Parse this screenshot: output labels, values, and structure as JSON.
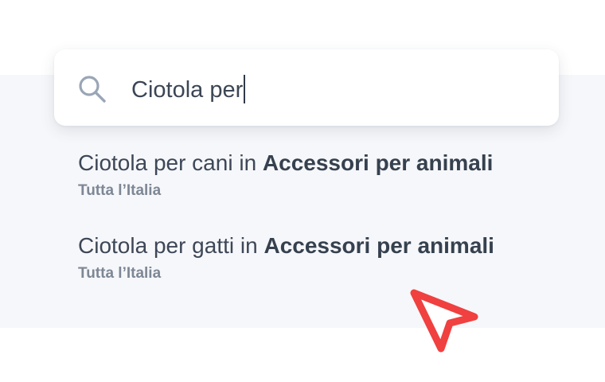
{
  "search": {
    "value": "Ciotola per",
    "icon": "search-icon"
  },
  "suggestions": [
    {
      "query": "Ciotola per cani",
      "connector": " in ",
      "category": "Accessori per animali",
      "location": "Tutta l’Italia"
    },
    {
      "query": "Ciotola per gatti",
      "connector": " in ",
      "category": "Accessori per animali",
      "location": "Tutta l’Italia"
    }
  ],
  "colors": {
    "panel_bg": "#f6f7fa",
    "text": "#3d4757",
    "subtext": "#7d8795",
    "cursor_arrow": "#f04040"
  }
}
